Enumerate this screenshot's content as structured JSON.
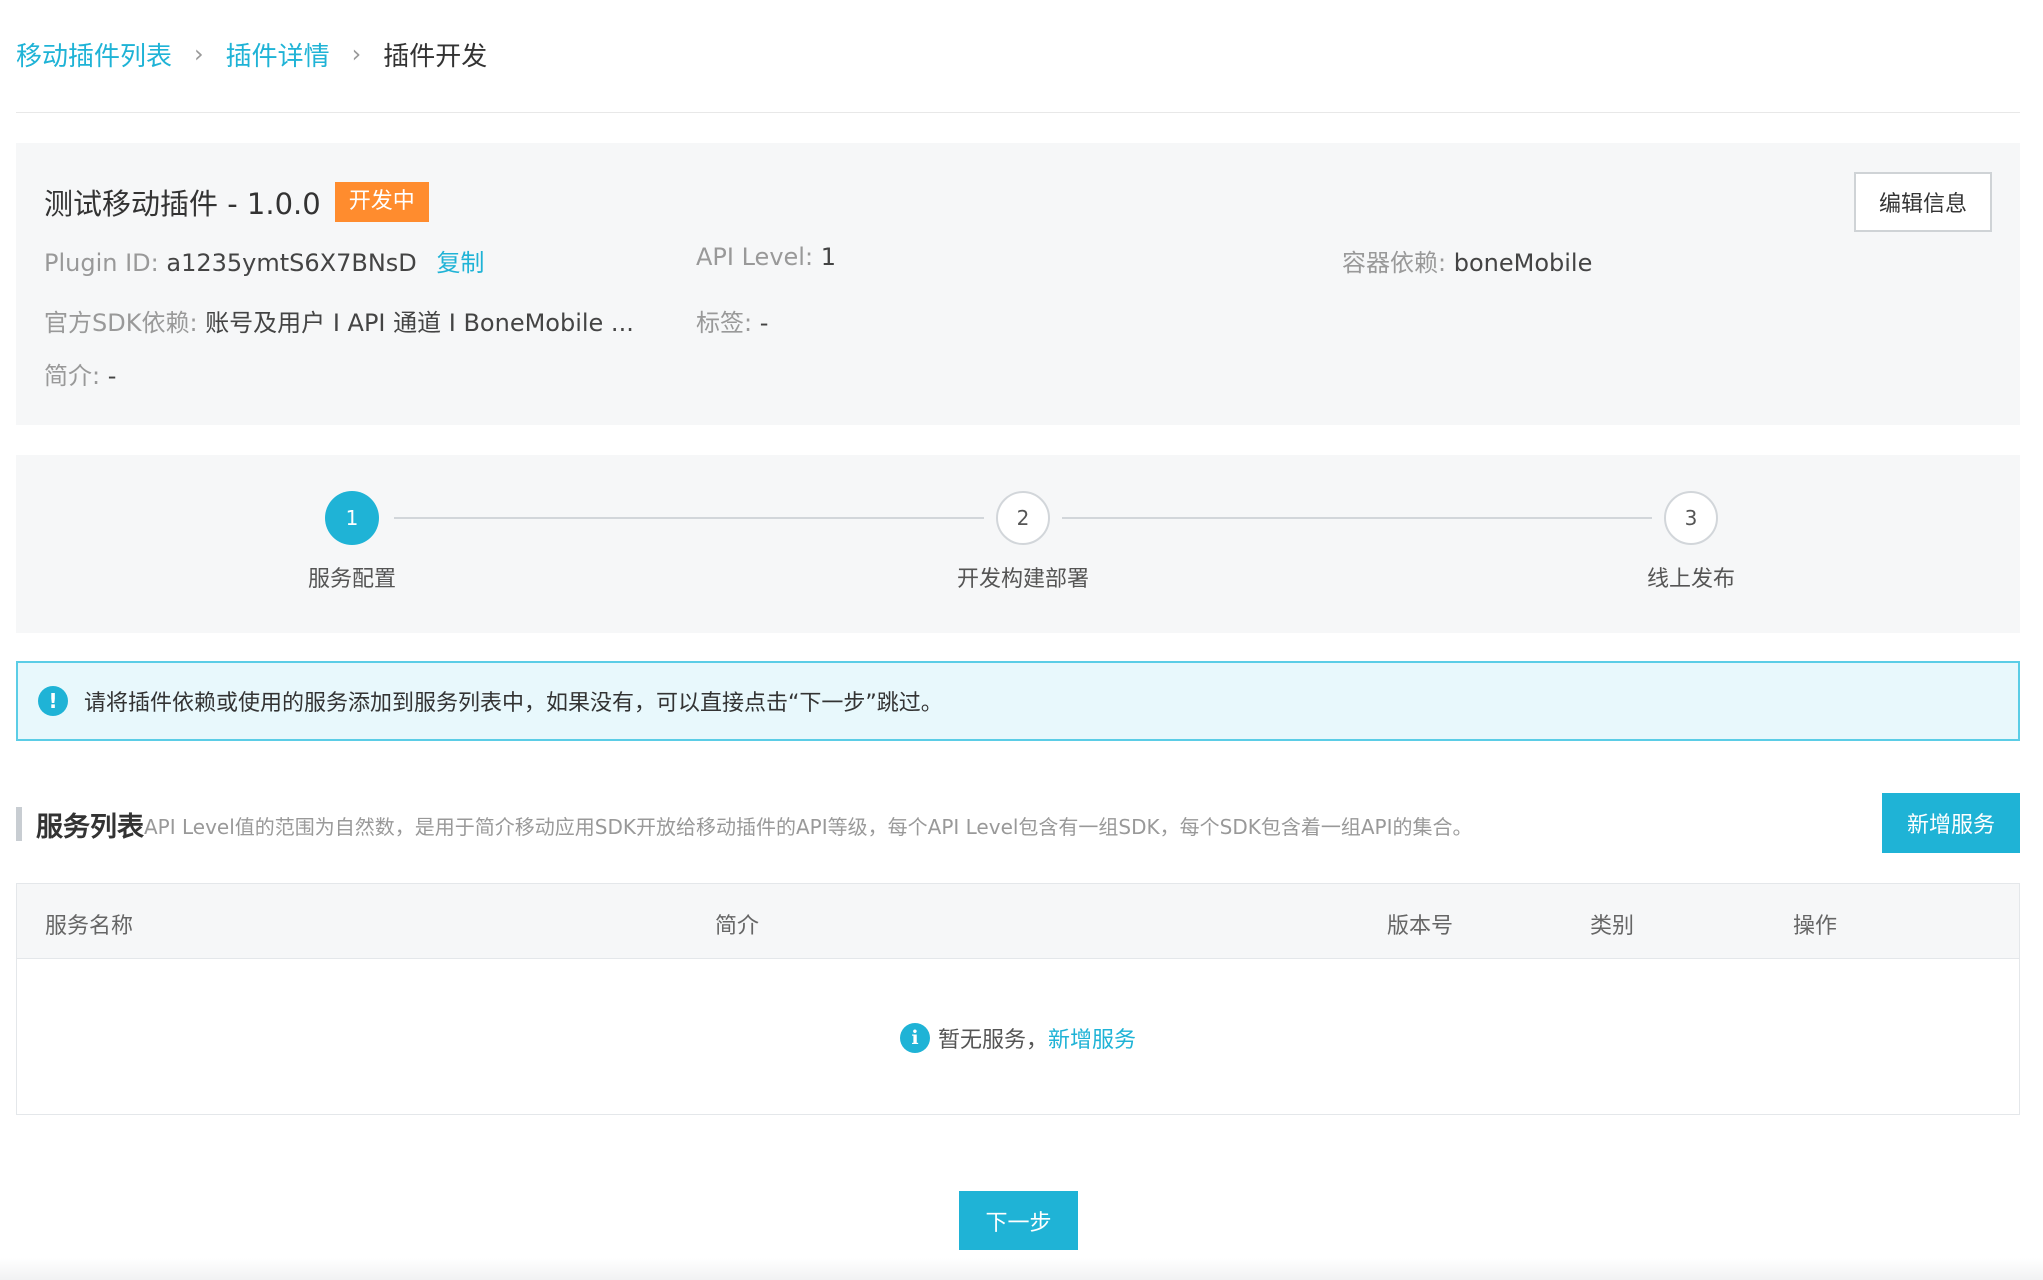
{
  "breadcrumb": {
    "items": [
      "移动插件列表",
      "插件详情"
    ],
    "separator": "›",
    "current": "插件开发"
  },
  "plugin": {
    "title": "测试移动插件 - 1.0.0",
    "status_badge": "开发中",
    "edit_label": "编辑信息",
    "plugin_id_label": "Plugin ID:",
    "plugin_id": "a1235ymtS6X7BNsD",
    "copy_label": "复制",
    "api_level_label": "API Level:",
    "api_level": "1",
    "container_label": "容器依赖:",
    "container": "boneMobile",
    "sdk_label": "官方SDK依赖:",
    "sdk": "账号及用户 I API 通道 I BoneMobile ...",
    "tags_label": "标签:",
    "tags": "-",
    "intro_label": "简介:",
    "intro": "-"
  },
  "steps": [
    {
      "number": "1",
      "label": "服务配置",
      "active": true
    },
    {
      "number": "2",
      "label": "开发构建部署",
      "active": false
    },
    {
      "number": "3",
      "label": "线上发布",
      "active": false
    }
  ],
  "alert": {
    "icon": "!",
    "text": "请将插件依赖或使用的服务添加到服务列表中，如果没有，可以直接点击“下一步”跳过。"
  },
  "service_list": {
    "title": "服务列表",
    "description": "API Level值的范围为自然数，是用于简介移动应用SDK开放给移动插件的API等级，每个API Level包含有一组SDK，每个SDK包含着一组API的集合。",
    "add_label": "新增服务",
    "columns": [
      "服务名称",
      "简介",
      "版本号",
      "类别",
      "操作"
    ],
    "empty_icon": "i",
    "empty_text": "暂无服务，",
    "empty_link": "新增服务"
  },
  "footer": {
    "next_label": "下一步"
  },
  "colors": {
    "accent": "#1fb3d6",
    "badge": "#ff8c2e",
    "panel": "#f6f7f8"
  }
}
